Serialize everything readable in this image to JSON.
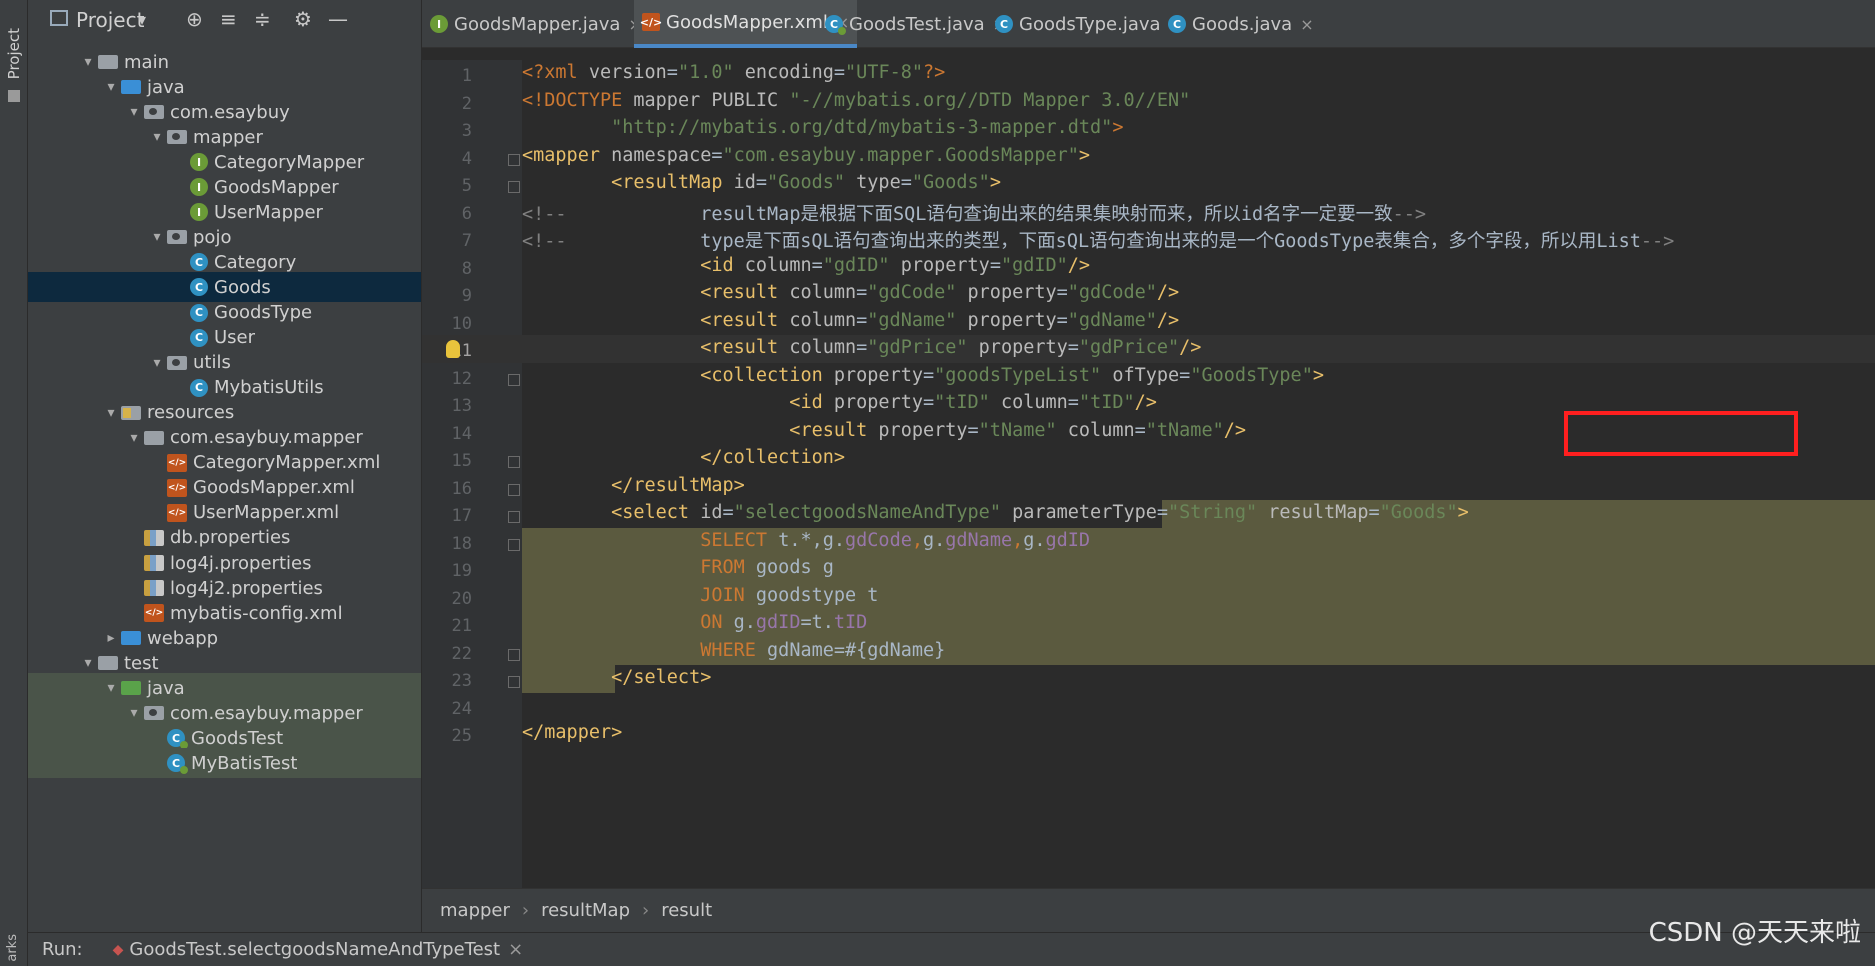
{
  "tool_strip": {
    "project_label": "Project",
    "bookmarks_label": "arks"
  },
  "project_panel": {
    "title": "Project",
    "toolbar": {
      "dropdown": "▾",
      "locate": "⊕",
      "expand": "≡",
      "collapse": "≑",
      "settings": "⚙",
      "hide": "—"
    },
    "tree": [
      {
        "label": "main",
        "icon": "folder",
        "depth": 0,
        "arrow": "▾"
      },
      {
        "label": "java",
        "icon": "folder-blue",
        "depth": 1,
        "arrow": "▾"
      },
      {
        "label": "com.esaybuy",
        "icon": "pkg",
        "depth": 2,
        "arrow": "▾"
      },
      {
        "label": "mapper",
        "icon": "pkg",
        "depth": 3,
        "arrow": "▾"
      },
      {
        "label": "CategoryMapper",
        "icon": "iface",
        "depth": 4,
        "arrow": ""
      },
      {
        "label": "GoodsMapper",
        "icon": "iface",
        "depth": 4,
        "arrow": ""
      },
      {
        "label": "UserMapper",
        "icon": "iface",
        "depth": 4,
        "arrow": ""
      },
      {
        "label": "pojo",
        "icon": "pkg",
        "depth": 3,
        "arrow": "▾"
      },
      {
        "label": "Category",
        "icon": "cls",
        "depth": 4,
        "arrow": ""
      },
      {
        "label": "Goods",
        "icon": "cls",
        "depth": 4,
        "arrow": "",
        "selected": true
      },
      {
        "label": "GoodsType",
        "icon": "cls",
        "depth": 4,
        "arrow": ""
      },
      {
        "label": "User",
        "icon": "cls",
        "depth": 4,
        "arrow": ""
      },
      {
        "label": "utils",
        "icon": "pkg",
        "depth": 3,
        "arrow": "▾"
      },
      {
        "label": "MybatisUtils",
        "icon": "cls",
        "depth": 4,
        "arrow": ""
      },
      {
        "label": "resources",
        "icon": "res",
        "depth": 1,
        "arrow": "▾"
      },
      {
        "label": "com.esaybuy.mapper",
        "icon": "folder",
        "depth": 2,
        "arrow": "▾"
      },
      {
        "label": "CategoryMapper.xml",
        "icon": "xml",
        "depth": 3,
        "arrow": ""
      },
      {
        "label": "GoodsMapper.xml",
        "icon": "xml",
        "depth": 3,
        "arrow": ""
      },
      {
        "label": "UserMapper.xml",
        "icon": "xml",
        "depth": 3,
        "arrow": ""
      },
      {
        "label": "db.properties",
        "icon": "props",
        "depth": 2,
        "arrow": ""
      },
      {
        "label": "log4j.properties",
        "icon": "props",
        "depth": 2,
        "arrow": ""
      },
      {
        "label": "log4j2.properties",
        "icon": "props",
        "depth": 2,
        "arrow": ""
      },
      {
        "label": "mybatis-config.xml",
        "icon": "xml",
        "depth": 2,
        "arrow": ""
      },
      {
        "label": "webapp",
        "icon": "web",
        "depth": 1,
        "arrow": "▸"
      },
      {
        "label": "test",
        "icon": "folder",
        "depth": 0,
        "arrow": "▾"
      },
      {
        "label": "java",
        "icon": "folder-green",
        "depth": 1,
        "arrow": "▾",
        "greenish": true
      },
      {
        "label": "com.esaybuy.mapper",
        "icon": "pkg",
        "depth": 2,
        "arrow": "▾",
        "greenish": true
      },
      {
        "label": "GoodsTest",
        "icon": "test",
        "depth": 3,
        "arrow": "",
        "greenish": true
      },
      {
        "label": "MyBatisTest",
        "icon": "test",
        "depth": 3,
        "arrow": "",
        "greenish": true
      }
    ]
  },
  "tabs": [
    {
      "label": "GoodsMapper.java",
      "icon": "iface",
      "active": false
    },
    {
      "label": "GoodsMapper.xml",
      "icon": "xml",
      "active": true
    },
    {
      "label": "GoodsTest.java",
      "icon": "test",
      "active": false
    },
    {
      "label": "GoodsType.java",
      "icon": "cls",
      "active": false
    },
    {
      "label": "Goods.java",
      "icon": "cls",
      "active": false
    }
  ],
  "tab_close_glyph": "×",
  "current_line": 11,
  "code_lines": [
    [
      [
        "p",
        "<?xml "
      ],
      [
        "a",
        "version"
      ],
      [
        "cm",
        "="
      ],
      [
        "v",
        "\"1.0\""
      ],
      [
        "a",
        " encoding"
      ],
      [
        "cm",
        "="
      ],
      [
        "v",
        "\"UTF-8\""
      ],
      [
        "p",
        "?>"
      ]
    ],
    [
      [
        "p",
        "<!DOCTYPE "
      ],
      [
        "a",
        "mapper PUBLIC "
      ],
      [
        "v",
        "\"-//mybatis.org//DTD Mapper 3.0//EN\""
      ]
    ],
    [
      [
        "v",
        "        \"http://mybatis.org/dtd/mybatis-3-mapper.dtd\""
      ],
      [
        "p",
        ">"
      ]
    ],
    [
      [
        "t",
        "<mapper "
      ],
      [
        "a",
        "namespace"
      ],
      [
        "cm",
        "="
      ],
      [
        "v",
        "\"com.esaybuy.mapper.GoodsMapper\""
      ],
      [
        "t",
        ">"
      ]
    ],
    [
      [
        "t",
        "        <resultMap "
      ],
      [
        "a",
        "id"
      ],
      [
        "cm",
        "="
      ],
      [
        "v",
        "\"Goods\""
      ],
      [
        "a",
        " type"
      ],
      [
        "cm",
        "="
      ],
      [
        "v",
        "\"Goods\""
      ],
      [
        "t",
        ">"
      ]
    ],
    [
      [
        "c",
        "<!--            "
      ],
      [
        "cm",
        "resultMap是根据下面SQL语句查询出来的结果集映射而来，所以id名字一定要一致"
      ],
      [
        "c",
        "-->"
      ]
    ],
    [
      [
        "c",
        "<!--            "
      ],
      [
        "cm",
        "type是下面sQL语句查询出来的类型，下面sQL语句查询出来的是一个GoodsType表集合，多个字段，所以用List"
      ],
      [
        "c",
        "-->"
      ]
    ],
    [
      [
        "t",
        "                <id "
      ],
      [
        "a",
        "column"
      ],
      [
        "cm",
        "="
      ],
      [
        "v",
        "\"gdID\""
      ],
      [
        "a",
        " property"
      ],
      [
        "cm",
        "="
      ],
      [
        "v",
        "\"gdID\""
      ],
      [
        "t",
        "/>"
      ]
    ],
    [
      [
        "t",
        "                <result "
      ],
      [
        "a",
        "column"
      ],
      [
        "cm",
        "="
      ],
      [
        "v",
        "\"gdCode\""
      ],
      [
        "a",
        " property"
      ],
      [
        "cm",
        "="
      ],
      [
        "v",
        "\"gdCode\""
      ],
      [
        "t",
        "/>"
      ]
    ],
    [
      [
        "t",
        "                <result "
      ],
      [
        "a",
        "column"
      ],
      [
        "cm",
        "="
      ],
      [
        "v",
        "\"gdName\""
      ],
      [
        "a",
        " property"
      ],
      [
        "cm",
        "="
      ],
      [
        "v",
        "\"gdName\""
      ],
      [
        "t",
        "/>"
      ]
    ],
    [
      [
        "t",
        "                <result "
      ],
      [
        "a",
        "column"
      ],
      [
        "cm",
        "="
      ],
      [
        "v",
        "\"gdPrice\""
      ],
      [
        "a",
        " property"
      ],
      [
        "cm",
        "="
      ],
      [
        "v",
        "\"gdPrice\""
      ],
      [
        "t",
        "/>"
      ]
    ],
    [
      [
        "t",
        "                <collection "
      ],
      [
        "a",
        "property"
      ],
      [
        "cm",
        "="
      ],
      [
        "v",
        "\"goodsTypeList\""
      ],
      [
        "a",
        " ofType"
      ],
      [
        "cm",
        "="
      ],
      [
        "v",
        "\"GoodsType\""
      ],
      [
        "t",
        ">"
      ]
    ],
    [
      [
        "t",
        "                        <id "
      ],
      [
        "a",
        "property"
      ],
      [
        "cm",
        "="
      ],
      [
        "v",
        "\"tID\""
      ],
      [
        "a",
        " column"
      ],
      [
        "cm",
        "="
      ],
      [
        "v",
        "\"tID\""
      ],
      [
        "t",
        "/>"
      ]
    ],
    [
      [
        "t",
        "                        <result "
      ],
      [
        "a",
        "property"
      ],
      [
        "cm",
        "="
      ],
      [
        "v",
        "\"tName\""
      ],
      [
        "a",
        " column"
      ],
      [
        "cm",
        "="
      ],
      [
        "v",
        "\"tName\""
      ],
      [
        "t",
        "/>"
      ]
    ],
    [
      [
        "t",
        "                </collection>"
      ]
    ],
    [
      [
        "t",
        "        </resultMap>"
      ]
    ],
    [
      [
        "t",
        "        <select "
      ],
      [
        "a",
        "id"
      ],
      [
        "cm",
        "="
      ],
      [
        "v",
        "\"selectgoodsNameAndType\""
      ],
      [
        "a",
        " parameterType"
      ],
      [
        "cm",
        "="
      ],
      [
        "v",
        "\"String\""
      ],
      [
        "a",
        " resultMap"
      ],
      [
        "cm",
        "="
      ],
      [
        "v",
        "\"Goods\""
      ],
      [
        "t",
        ">"
      ]
    ],
    [
      [
        "k",
        "                SELECT "
      ],
      [
        "cm",
        "t.*,g."
      ],
      [
        "f",
        "gdCode"
      ],
      [
        "k",
        ","
      ],
      [
        "cm",
        "g."
      ],
      [
        "f",
        "gdName"
      ],
      [
        "k",
        ","
      ],
      [
        "cm",
        "g."
      ],
      [
        "f",
        "gdID"
      ]
    ],
    [
      [
        "k",
        "                FROM "
      ],
      [
        "cm",
        "goods g"
      ]
    ],
    [
      [
        "k",
        "                JOIN "
      ],
      [
        "cm",
        "goodstype t"
      ]
    ],
    [
      [
        "k",
        "                ON "
      ],
      [
        "cm",
        "g."
      ],
      [
        "f",
        "gdID"
      ],
      [
        "cm",
        "=t."
      ],
      [
        "f",
        "tID"
      ]
    ],
    [
      [
        "k",
        "                WHERE "
      ],
      [
        "cm",
        "gdName=#{gdName}"
      ]
    ],
    [
      [
        "t",
        "        </select>"
      ]
    ],
    [
      [
        "cm",
        ""
      ]
    ],
    [
      [
        "t",
        "</mapper>"
      ]
    ]
  ],
  "breadcrumb": [
    "mapper",
    "resultMap",
    "result"
  ],
  "breadcrumb_sep": "›",
  "run_bar": {
    "label": "Run:",
    "config": "GoodsTest.selectgoodsNameAndTypeTest",
    "close": "×"
  },
  "watermark": "CSDN @天天来啦"
}
